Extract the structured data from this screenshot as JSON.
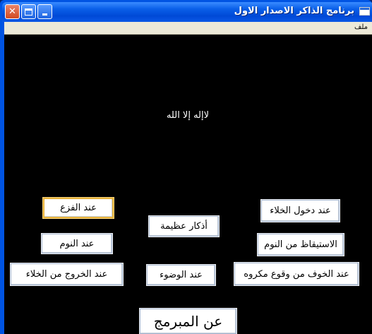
{
  "window": {
    "title": "برنامج الذاكر الاصدار الاول",
    "controls": {
      "close": "✕"
    }
  },
  "menu": {
    "file_label": "ملف"
  },
  "main": {
    "center_text": "لاإله إلا الله",
    "buttons": {
      "fear": "عند الفزع",
      "entering_toilet": "عند دخول الخلاء",
      "great_adhkar": "أذكار عظيمة",
      "sleep": "عند النوم",
      "waking": "الاستيقاظ من النوم",
      "leaving_toilet": "عند الخروج من الخلاء",
      "wudu": "عند الوضوء",
      "fear_of_harm": "عند الخوف من وقوع مكروه",
      "about_programmer": "عن المبرمج"
    }
  }
}
